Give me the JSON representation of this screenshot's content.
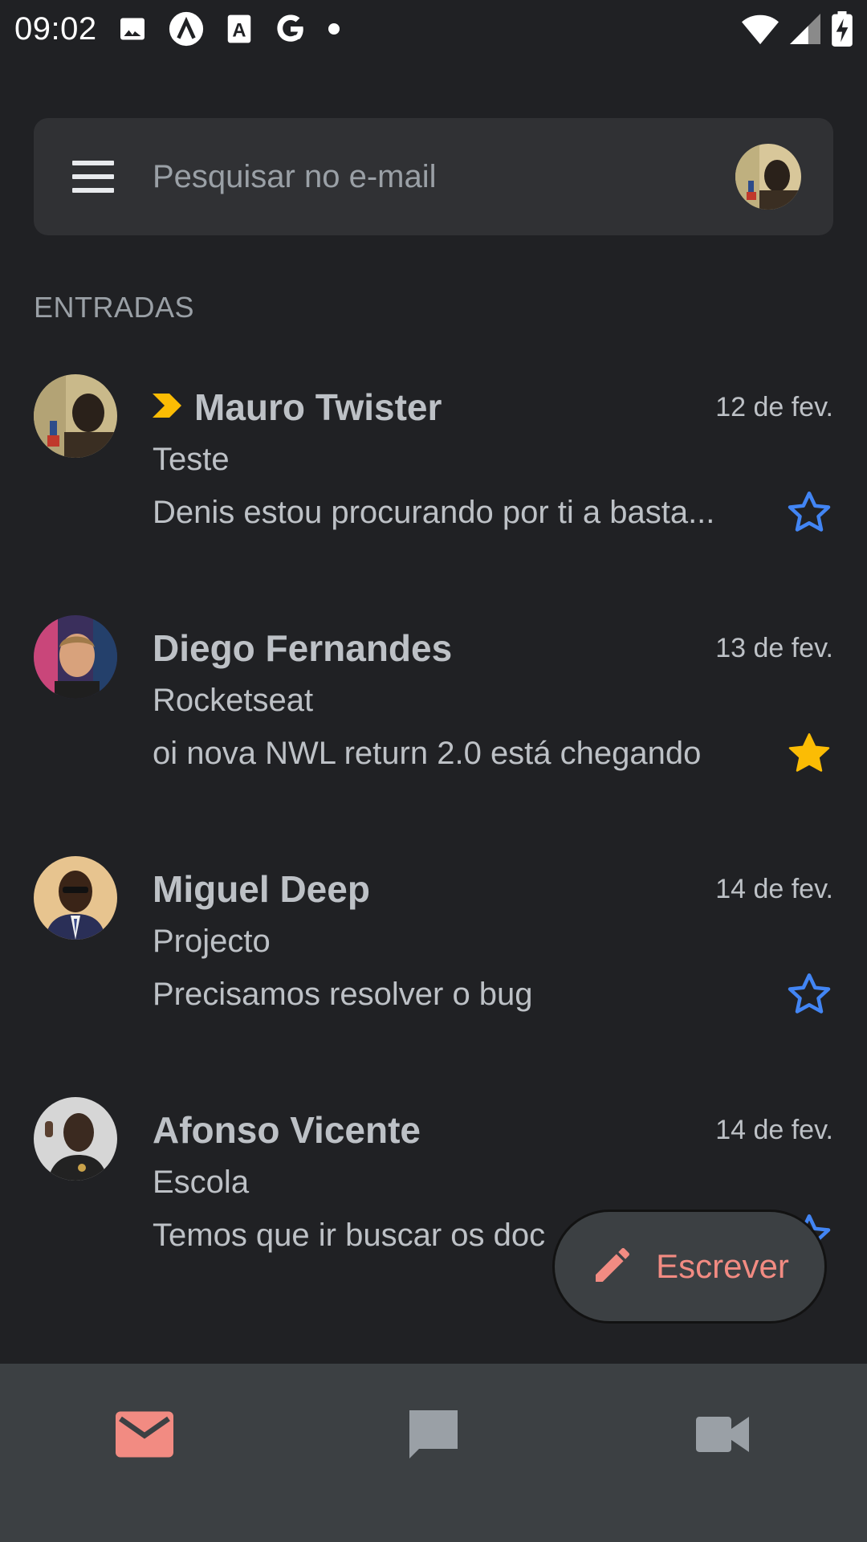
{
  "status_bar": {
    "time": "09:02",
    "left_icons": [
      "image-icon",
      "lambda-app-icon",
      "text-a-icon",
      "google-g-icon",
      "dot-icon"
    ],
    "right_icons": [
      "wifi-icon",
      "signal-icon",
      "battery-charging-icon"
    ]
  },
  "search": {
    "placeholder": "Pesquisar no e-mail"
  },
  "section": {
    "label": "ENTRADAS"
  },
  "emails": [
    {
      "sender": "Mauro Twister",
      "date": "12 de fev.",
      "subject": "Teste",
      "preview": "Denis estou procurando por ti a basta...",
      "starred": false,
      "important": true,
      "avatar_colors": [
        "#6b5a3a",
        "#2a241c"
      ]
    },
    {
      "sender": "Diego Fernandes",
      "date": "13 de fev.",
      "subject": "Rocketseat",
      "preview": "oi nova NWL return 2.0 está chegando",
      "starred": true,
      "important": false,
      "avatar_colors": [
        "#c9467a",
        "#d8a27c"
      ]
    },
    {
      "sender": "Miguel Deep",
      "date": "14 de fev.",
      "subject": "Projecto",
      "preview": "Precisamos resolver o bug",
      "starred": false,
      "important": false,
      "avatar_colors": [
        "#e7c48f",
        "#2a2f57"
      ]
    },
    {
      "sender": "Afonso Vicente",
      "date": "14 de fev.",
      "subject": "Escola",
      "preview": "Temos que ir buscar os doc",
      "starred": false,
      "important": false,
      "avatar_colors": [
        "#cfcfcf",
        "#2b2520"
      ]
    }
  ],
  "fab": {
    "label": "Escrever",
    "icon": "pencil-icon"
  },
  "bottom_nav": {
    "items": [
      "mail-icon",
      "chat-icon",
      "video-icon"
    ],
    "active": "mail-icon"
  },
  "colors": {
    "background": "#202124",
    "surface": "#303134",
    "nav_bg": "#3c4043",
    "accent": "#f28b82",
    "star_blue": "#4285f4",
    "star_yellow": "#fbbc04",
    "important_marker": "#fbbc04"
  }
}
